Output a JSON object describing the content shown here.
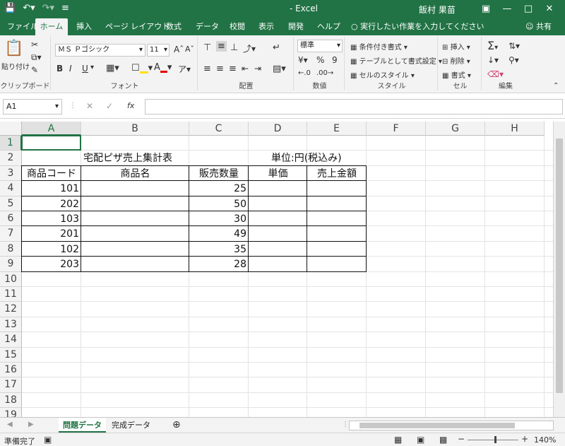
{
  "titlebar": {
    "save_icon": "save-icon",
    "undo_icon": "undo-icon",
    "redo_icon": "redo-icon",
    "title": "- Excel",
    "user": "飯村 果苗",
    "buttons": [
      "ribbon-options",
      "minimize",
      "restore",
      "close"
    ]
  },
  "tabs": [
    {
      "label": "ファイル"
    },
    {
      "label": "ホーム"
    },
    {
      "label": "挿入"
    },
    {
      "label": "ページ レイアウト"
    },
    {
      "label": "数式"
    },
    {
      "label": "データ"
    },
    {
      "label": "校閲"
    },
    {
      "label": "表示"
    },
    {
      "label": "開発"
    },
    {
      "label": "ヘルプ"
    }
  ],
  "tellme": "実行したい作業を入力してください",
  "share": "共有",
  "ribbon": {
    "clipboard": {
      "paste": "貼り付け",
      "label": "クリップボード"
    },
    "font": {
      "name": "ＭＳ Ｐゴシック",
      "size": "11",
      "grow": "A",
      "shrink": "A",
      "bold": "B",
      "italic": "I",
      "underline": "U",
      "label": "フォント"
    },
    "align": {
      "label": "配置"
    },
    "number": {
      "format": "標準",
      "percent": "%",
      "comma": "9",
      "label": "数値"
    },
    "styles": {
      "conditional": "条件付き書式",
      "table": "テーブルとして書式設定",
      "cell": "セルのスタイル",
      "label": "スタイル"
    },
    "cells": {
      "insert": "挿入",
      "delete": "削除",
      "format": "書式",
      "label": "セル"
    },
    "editing": {
      "label": "編集"
    }
  },
  "formula_bar": {
    "name_box": "A1",
    "fx": "fx",
    "content": ""
  },
  "grid": {
    "columns": [
      "A",
      "B",
      "C",
      "D",
      "E",
      "F",
      "G",
      "H"
    ],
    "rows": [
      "1",
      "2",
      "3",
      "4",
      "5",
      "6",
      "7",
      "8",
      "9",
      "10",
      "11",
      "12",
      "13",
      "14",
      "15",
      "16",
      "17",
      "18",
      "19"
    ],
    "title": "宅配ピザ売上集計表",
    "unit": "単位:円(税込み)",
    "headers": [
      "商品コード",
      "商品名",
      "販売数量",
      "単価",
      "売上金額"
    ],
    "data": [
      {
        "code": "101",
        "qty": "25"
      },
      {
        "code": "202",
        "qty": "50"
      },
      {
        "code": "103",
        "qty": "30"
      },
      {
        "code": "201",
        "qty": "49"
      },
      {
        "code": "102",
        "qty": "35"
      },
      {
        "code": "203",
        "qty": "28"
      }
    ]
  },
  "sheets": [
    {
      "name": "問題データ",
      "active": true
    },
    {
      "name": "完成データ",
      "active": false
    }
  ],
  "status": {
    "ready": "準備完了",
    "zoom": "140%"
  },
  "colors": {
    "accent": "#217346"
  }
}
